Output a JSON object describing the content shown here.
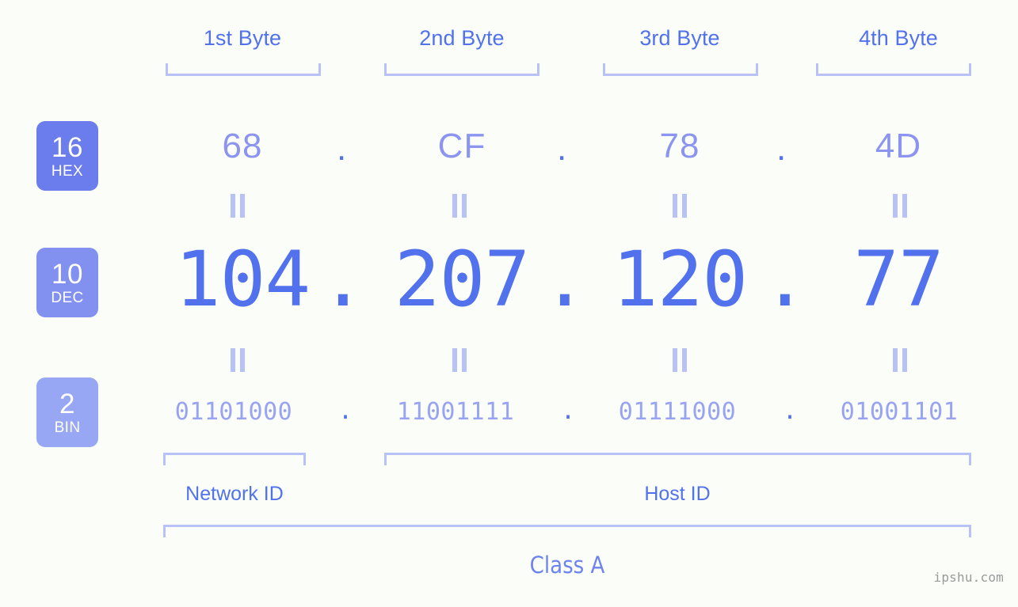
{
  "background_color": "#fbfdf8",
  "accent_color": "#5271ed",
  "accent_light": "#8b95ef",
  "bracket_color": "#b9c2f7",
  "headers": [
    {
      "label": "1st Byte"
    },
    {
      "label": "2nd Byte"
    },
    {
      "label": "3rd Byte"
    },
    {
      "label": "4th Byte"
    }
  ],
  "bases": [
    {
      "number": "16",
      "name": "HEX",
      "color": "#6b7ced"
    },
    {
      "number": "10",
      "name": "DEC",
      "color": "#8291f0"
    },
    {
      "number": "2",
      "name": "BIN",
      "color": "#98a7f3"
    }
  ],
  "rows": {
    "hex": {
      "values": [
        "68",
        "CF",
        "78",
        "4D"
      ],
      "separator": "."
    },
    "dec": {
      "values": [
        "104",
        "207",
        "120",
        "77"
      ],
      "separator": "."
    },
    "bin": {
      "values": [
        "01101000",
        "11001111",
        "01111000",
        "01001101"
      ],
      "separator": "."
    }
  },
  "equality_mark": "=",
  "segments": {
    "network_id": "Network ID",
    "host_id": "Host ID"
  },
  "class_label": "Class A",
  "watermark": "ipshu.com"
}
